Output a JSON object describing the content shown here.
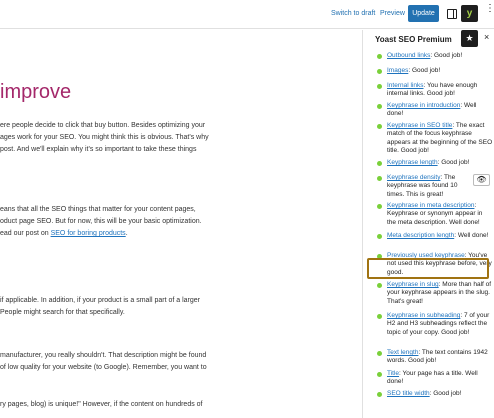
{
  "topbar": {
    "switch_to_draft": "Switch to draft",
    "preview": "Preview",
    "update": "Update",
    "yoast_logo": "y",
    "more_glyph": "⋮",
    "accent": "#2271b1"
  },
  "editor": {
    "heading": "improve",
    "heading_color": "#a4286a",
    "paragraphs": [
      "ere people decide to click that buy button. Besides optimizing your",
      "ages work for your SEO. You might think this is obvious. That's why",
      "post. And we'll explain why it's so important to take these things",
      "eans that all the SEO things that matter for your content pages,",
      "oduct page SEO. But for now, this will be your basic optimization.",
      "ead our post on ",
      "SEO for boring products",
      ".",
      "if applicable. In addition, if your product is a small part of a larger",
      "People might search for that specifically.",
      "manufacturer, you really shouldn't. That description might be found",
      "of low quality for your website (to Google). Remember, you want to",
      "ry pages, blog) is unique!\" However, if the content on hundreds of"
    ]
  },
  "sidebar": {
    "title": "Yoast SEO Premium",
    "star_glyph": "★",
    "close_glyph": "×",
    "eye_glyph": "👁",
    "good_color": "#7ad03a",
    "highlight_color": "#a07312",
    "items": [
      {
        "link": "Outbound links",
        "text": ": Good job!"
      },
      {
        "link": "Images",
        "text": ": Good job!"
      },
      {
        "link": "Internal links",
        "text": ": You have enough internal links. Good job!"
      },
      {
        "link": "Keyphrase in introduction",
        "text": ": Well done!"
      },
      {
        "link": "Keyphrase in SEO title",
        "text": ": The exact match of the focus keyphrase appears at the beginning of the SEO title. Good job!"
      },
      {
        "link": "Keyphrase length",
        "text": ": Good job!"
      },
      {
        "link": "Keyphrase density",
        "text": ": The keyphrase was found 10 times. This is great!"
      },
      {
        "link": "Keyphrase in meta description",
        "text": ": Keyphrase or synonym appear in the meta description. Well done!"
      },
      {
        "link": "Meta description length",
        "text": ": Well done!"
      },
      {
        "link": "Previously used keyphrase",
        "text": ": You've not used this keyphrase before, very good."
      },
      {
        "link": "Keyphrase in slug",
        "text": ": More than half of your keyphrase appears in the slug. That's great!"
      },
      {
        "link": "Keyphrase in subheading",
        "text": ": 7 of your H2 and H3 subheadings reflect the topic of your copy. Good job!"
      },
      {
        "link": "Text length",
        "text": ": The text contains 1942 words. Good job!"
      },
      {
        "link": "Title",
        "text": ": Your page has a title. Well done!"
      },
      {
        "link": "SEO title width",
        "text": ": Good job!"
      }
    ]
  }
}
